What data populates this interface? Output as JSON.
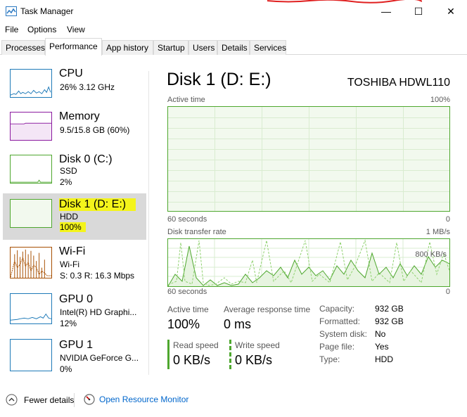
{
  "window": {
    "title": "Task Manager",
    "minimize_glyph": "—",
    "maximize_glyph": "☐",
    "close_glyph": "✕"
  },
  "menu": [
    "File",
    "Options",
    "View"
  ],
  "tabs": [
    "Processes",
    "Performance",
    "App history",
    "Startup",
    "Users",
    "Details",
    "Services"
  ],
  "active_tab": "Performance",
  "resources": [
    {
      "title": "CPU",
      "sub1": "26%  3.12 GHz",
      "sub2": "",
      "color": "#1e7ab8"
    },
    {
      "title": "Memory",
      "sub1": "9.5/15.8 GB (60%)",
      "sub2": "",
      "color": "#8b1a9f"
    },
    {
      "title": "Disk 0 (C:)",
      "sub1": "SSD",
      "sub2": "2%",
      "color": "#4ea72e"
    },
    {
      "title": "Disk 1 (D: E:)",
      "sub1": "HDD",
      "sub2": "100%",
      "color": "#4ea72e"
    },
    {
      "title": "Wi-Fi",
      "sub1": "Wi-Fi",
      "sub2": "S: 0.3  R: 16.3 Mbps",
      "color": "#a74f01"
    },
    {
      "title": "GPU 0",
      "sub1": "Intel(R) HD Graphi...",
      "sub2": "12%",
      "color": "#1e7ab8"
    },
    {
      "title": "GPU 1",
      "sub1": "NVIDIA GeForce G...",
      "sub2": "0%",
      "color": "#1e7ab8"
    }
  ],
  "main": {
    "title": "Disk 1 (D: E:)",
    "model": "TOSHIBA HDWL110",
    "chart1": {
      "label": "Active time",
      "max_label": "100%",
      "x_left": "60 seconds",
      "x_right": "0"
    },
    "chart2": {
      "label": "Disk transfer rate",
      "max_label": "1 MB/s",
      "mid_label": "800 KB/s",
      "x_left": "60 seconds",
      "x_right": "0"
    },
    "stats": {
      "active_time_label": "Active time",
      "active_time_value": "100%",
      "avg_response_label": "Average response time",
      "avg_response_value": "0 ms",
      "read_speed_label": "Read speed",
      "read_speed_value": "0 KB/s",
      "write_speed_label": "Write speed",
      "write_speed_value": "0 KB/s"
    },
    "info": [
      {
        "label": "Capacity:",
        "value": "932 GB"
      },
      {
        "label": "Formatted:",
        "value": "932 GB"
      },
      {
        "label": "System disk:",
        "value": "No"
      },
      {
        "label": "Page file:",
        "value": "Yes"
      },
      {
        "label": "Type:",
        "value": "HDD"
      }
    ]
  },
  "footer": {
    "fewer_details": "Fewer details",
    "open_resource_monitor": "Open Resource Monitor"
  },
  "colors": {
    "disk_green": "#4ea72e",
    "highlight": "#f4f41b",
    "link_blue": "#0066cc"
  }
}
